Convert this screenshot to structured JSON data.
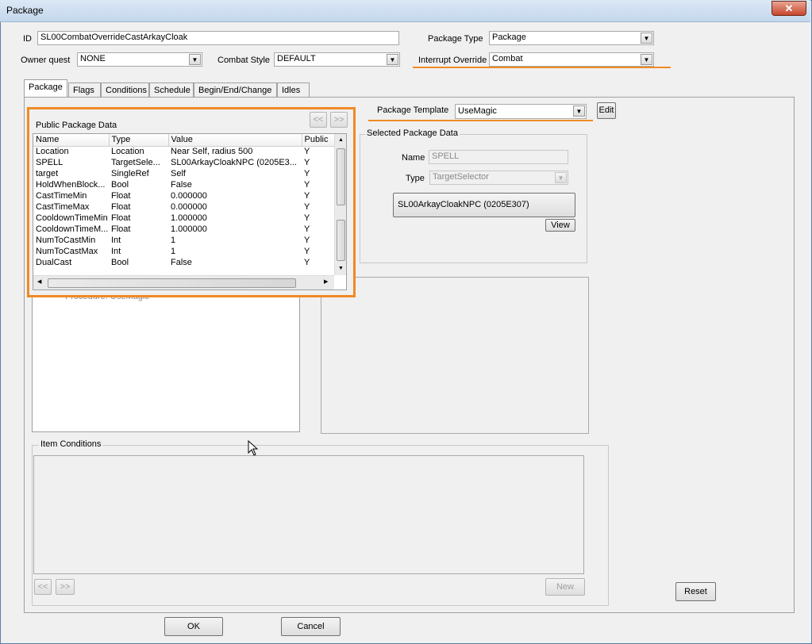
{
  "window": {
    "title": "Package",
    "close_symbol": "✕"
  },
  "form": {
    "id_label": "ID",
    "id_value": "SL00CombatOverrideCastArkayCloak",
    "owner_quest_label": "Owner quest",
    "owner_quest_value": "NONE",
    "combat_style_label": "Combat Style",
    "combat_style_value": "DEFAULT",
    "package_type_label": "Package Type",
    "package_type_value": "Package",
    "interrupt_override_label": "Interrupt Override",
    "interrupt_override_value": "Combat"
  },
  "tabs": [
    {
      "label": "Package"
    },
    {
      "label": "Flags"
    },
    {
      "label": "Conditions"
    },
    {
      "label": "Schedule"
    },
    {
      "label": "Begin/End/Change"
    },
    {
      "label": "Idles"
    }
  ],
  "public_data": {
    "title": "Public Package Data",
    "prev_label": "<<",
    "next_label": ">>",
    "columns": [
      "Name",
      "Type",
      "Value",
      "Public"
    ],
    "rows": [
      {
        "name": "Location",
        "type": "Location",
        "value": "Near Self, radius 500",
        "public": "Y"
      },
      {
        "name": "SPELL",
        "type": "TargetSele...",
        "value": "SL00ArkayCloakNPC (0205E3...",
        "public": "Y"
      },
      {
        "name": "target",
        "type": "SingleRef",
        "value": "Self",
        "public": "Y"
      },
      {
        "name": "HoldWhenBlock...",
        "type": "Bool",
        "value": "False",
        "public": "Y"
      },
      {
        "name": "CastTimeMin",
        "type": "Float",
        "value": "0.000000",
        "public": "Y"
      },
      {
        "name": "CastTimeMax",
        "type": "Float",
        "value": "0.000000",
        "public": "Y"
      },
      {
        "name": "CooldownTimeMin",
        "type": "Float",
        "value": "1.000000",
        "public": "Y"
      },
      {
        "name": "CooldownTimeM...",
        "type": "Float",
        "value": "1.000000",
        "public": "Y"
      },
      {
        "name": "NumToCastMin",
        "type": "Int",
        "value": "1",
        "public": "Y"
      },
      {
        "name": "NumToCastMax",
        "type": "Int",
        "value": "1",
        "public": "Y"
      },
      {
        "name": "DualCast",
        "type": "Bool",
        "value": "False",
        "public": "Y"
      }
    ],
    "tree_text": "--- Procedure: UseMagic"
  },
  "template": {
    "label": "Package Template",
    "value": "UseMagic",
    "edit_label": "Edit"
  },
  "selected": {
    "title": "Selected Package Data",
    "name_label": "Name",
    "name_value": "SPELL",
    "type_label": "Type",
    "type_value": "TargetSelector",
    "spell_button": "SL00ArkayCloakNPC (0205E307)",
    "view_label": "View"
  },
  "item_conditions": {
    "title": "Item Conditions",
    "prev_label": "<<",
    "next_label": ">>",
    "new_label": "New"
  },
  "buttons": {
    "reset": "Reset",
    "ok": "OK",
    "cancel": "Cancel"
  },
  "colors": {
    "highlight": "#f08a24",
    "titlebar": "#c4d7ec",
    "close": "#c8452c"
  }
}
